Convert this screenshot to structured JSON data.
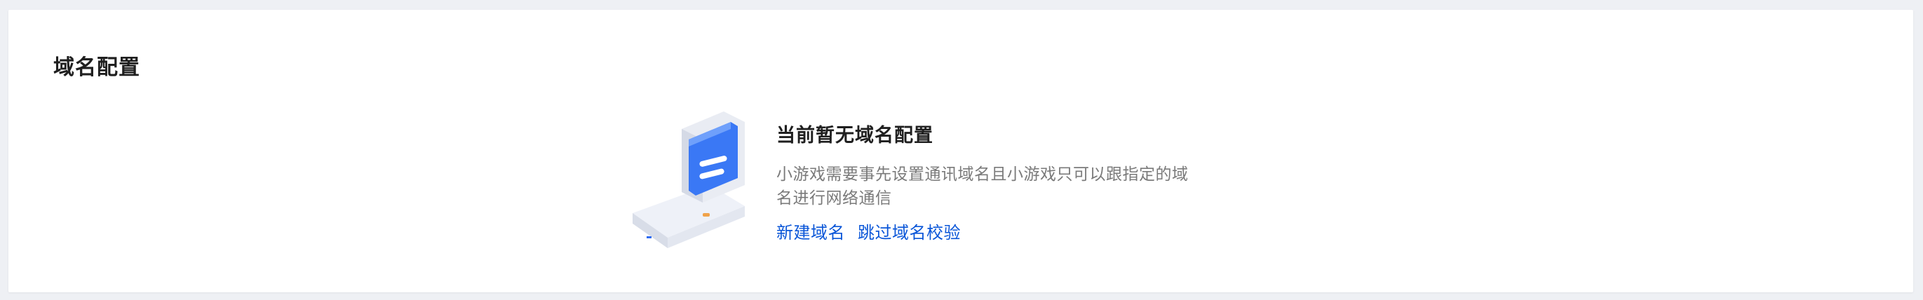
{
  "panel": {
    "title": "域名配置"
  },
  "empty_state": {
    "title": "当前暂无域名配置",
    "description": "小游戏需要事先设置通讯域名且小游戏只可以跟指定的域名进行网络通信",
    "actions": {
      "create_label": "新建域名",
      "skip_label": "跳过域名校验"
    },
    "illustration_icon": "server-monitor-icon"
  },
  "colors": {
    "link": "#0a56d8",
    "accent_blue": "#2f6cf2",
    "page_bg": "#eef0f4"
  }
}
